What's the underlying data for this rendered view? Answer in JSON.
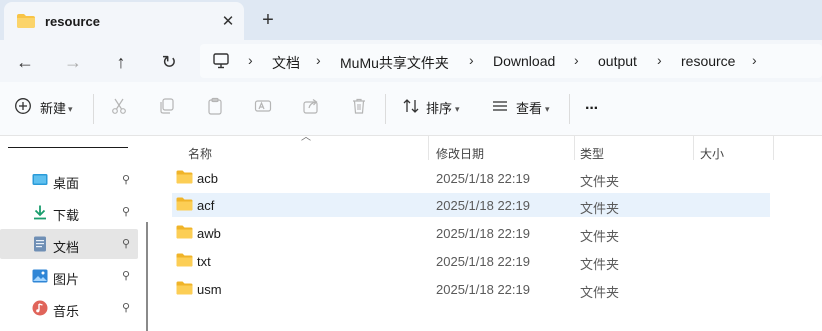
{
  "tab": {
    "title": "resource",
    "close": "✕",
    "new_tab": "+"
  },
  "nav": {
    "back": "←",
    "forward": "→",
    "up": "↑",
    "refresh": "↻"
  },
  "breadcrumb": {
    "items": [
      "文档",
      "MuMu共享文件夹",
      "Download",
      "output",
      "resource"
    ],
    "separator": "›"
  },
  "commandbar": {
    "new_label": "新建",
    "sort_label": "排序",
    "view_label": "查看",
    "more_label": "···"
  },
  "sidebar": {
    "items": [
      {
        "label": "桌面",
        "icon": "desktop-icon"
      },
      {
        "label": "下载",
        "icon": "download-icon"
      },
      {
        "label": "文档",
        "icon": "documents-icon"
      },
      {
        "label": "图片",
        "icon": "pictures-icon"
      },
      {
        "label": "音乐",
        "icon": "music-icon"
      }
    ],
    "pin": "📌"
  },
  "filelist": {
    "columns": {
      "name": "名称",
      "modified": "修改日期",
      "type": "类型",
      "size": "大小"
    },
    "rows": [
      {
        "name": "acb",
        "modified": "2025/1/18 22:19",
        "type": "文件夹"
      },
      {
        "name": "acf",
        "modified": "2025/1/18 22:19",
        "type": "文件夹"
      },
      {
        "name": "awb",
        "modified": "2025/1/18 22:19",
        "type": "文件夹"
      },
      {
        "name": "txt",
        "modified": "2025/1/18 22:19",
        "type": "文件夹"
      },
      {
        "name": "usm",
        "modified": "2025/1/18 22:19",
        "type": "文件夹"
      }
    ]
  },
  "colors": {
    "accent": "#0067c0",
    "folder": "#f8c446",
    "tabstrip": "#dfe8f3",
    "selection": "#e8f2fc"
  }
}
